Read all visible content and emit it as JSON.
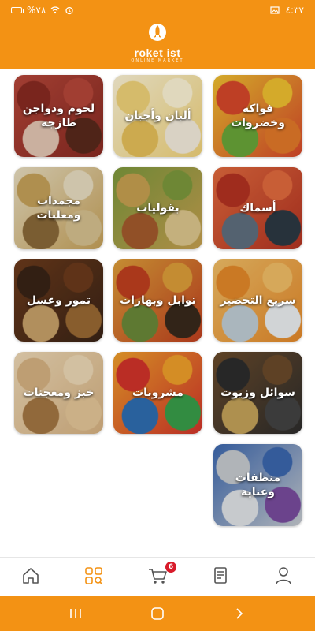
{
  "status_bar": {
    "time": "٤:٣٧",
    "battery": "%٧٨"
  },
  "header": {
    "brand": "roket ist",
    "tagline": "ONLINE MARKET",
    "brand_color": "#F39214"
  },
  "categories": [
    {
      "label": "فواكه وخضروات",
      "palette": [
        "#d9482b",
        "#f2c230",
        "#6aa83a",
        "#e57a2a"
      ]
    },
    {
      "label": "ألبان وأجبان",
      "palette": [
        "#f3d57a",
        "#fff6d8",
        "#e9c25a",
        "#f7efe0"
      ]
    },
    {
      "label": "لحوم ودواجن طازجة",
      "palette": [
        "#8a2b22",
        "#b8473a",
        "#e6c9b5",
        "#5b2a1c"
      ]
    },
    {
      "label": "أسماك",
      "palette": [
        "#b53322",
        "#e46b3e",
        "#607080",
        "#2d3a44"
      ]
    },
    {
      "label": "بقوليات",
      "palette": [
        "#c9a251",
        "#7e9a3d",
        "#a65c2d",
        "#e0c98f"
      ]
    },
    {
      "label": "مجمدات ومعلبات",
      "palette": [
        "#c8a35a",
        "#ebe0c3",
        "#8b6a3a",
        "#d9c391"
      ]
    },
    {
      "label": "سريع التحضير",
      "palette": [
        "#e68a2a",
        "#f4c067",
        "#c2d0d8",
        "#eef2f4"
      ]
    },
    {
      "label": "توابل وبهارات",
      "palette": [
        "#c2401f",
        "#e0a03a",
        "#6b8a3a",
        "#3a2a1c"
      ]
    },
    {
      "label": "تمور وعسل",
      "palette": [
        "#3a2416",
        "#6d3b1c",
        "#caa36a",
        "#9b6a34"
      ]
    },
    {
      "label": "سوائل وزيوت",
      "palette": [
        "#2d2d2d",
        "#6b4b2b",
        "#c7a45a",
        "#444"
      ]
    },
    {
      "label": "مشروبات",
      "palette": [
        "#d4342b",
        "#f2a12b",
        "#2f6fb3",
        "#3aa04a"
      ]
    },
    {
      "label": "خبز ومعجنات",
      "palette": [
        "#d9b483",
        "#f0dbb8",
        "#a67844",
        "#e7c99a"
      ]
    },
    {
      "label": "منظفات وعناية",
      "palette": [
        "#c9cdd2",
        "#3c68b0",
        "#e3e6ea",
        "#7a4da0"
      ]
    }
  ],
  "bottom_nav": {
    "items": [
      "home",
      "categories",
      "cart",
      "orders",
      "account"
    ],
    "cart_badge": "6",
    "active_color": "#F39214",
    "badge_color": "#d81b2a"
  }
}
